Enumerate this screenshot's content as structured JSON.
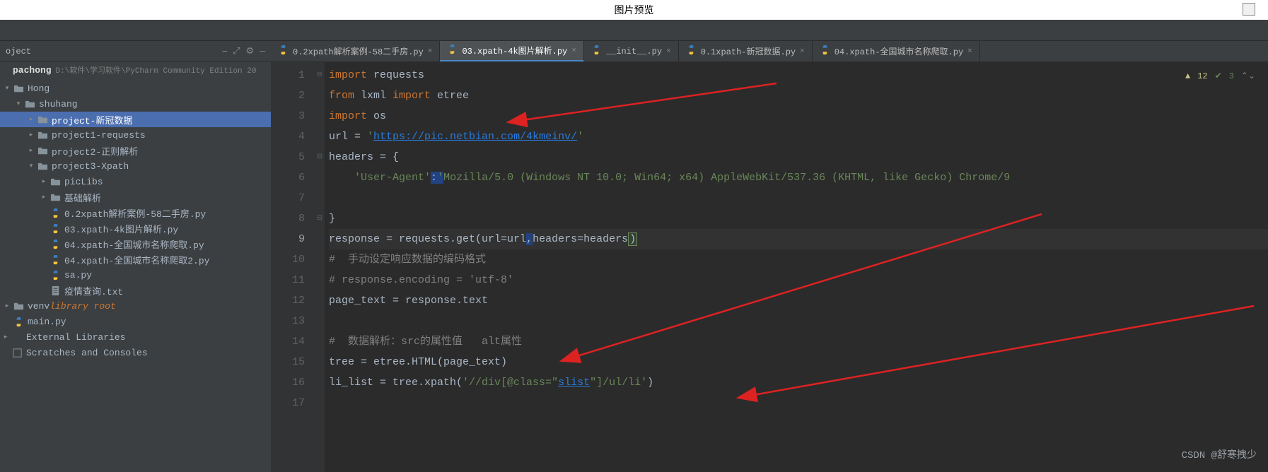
{
  "preview": {
    "title": "图片预览"
  },
  "sidebar": {
    "header_label": "oject",
    "active_project": "pachong",
    "project_path": "D:\\软件\\学习软件\\PyCharm Community Edition 20",
    "tree": [
      {
        "label": "Hong",
        "icon": "folder",
        "indent": 0,
        "arrow": "down",
        "sel": false
      },
      {
        "label": "shuhang",
        "icon": "folder",
        "indent": 1,
        "arrow": "down",
        "sel": false
      },
      {
        "label": "project-新冠数据",
        "icon": "folder",
        "indent": 2,
        "arrow": "right",
        "sel": true
      },
      {
        "label": "project1-requests",
        "icon": "folder",
        "indent": 2,
        "arrow": "right",
        "sel": false
      },
      {
        "label": "project2-正则解析",
        "icon": "folder",
        "indent": 2,
        "arrow": "right",
        "sel": false
      },
      {
        "label": "project3-Xpath",
        "icon": "folder",
        "indent": 2,
        "arrow": "down",
        "sel": false
      },
      {
        "label": "picLibs",
        "icon": "folder",
        "indent": 3,
        "arrow": "right",
        "sel": false
      },
      {
        "label": "基础解析",
        "icon": "folder",
        "indent": 3,
        "arrow": "right",
        "sel": false
      },
      {
        "label": "0.2xpath解析案例-58二手房.py",
        "icon": "py",
        "indent": 3,
        "arrow": "",
        "sel": false
      },
      {
        "label": "03.xpath-4k图片解析.py",
        "icon": "py",
        "indent": 3,
        "arrow": "",
        "sel": false
      },
      {
        "label": "04.xpath-全国城市名称爬取.py",
        "icon": "py",
        "indent": 3,
        "arrow": "",
        "sel": false
      },
      {
        "label": "04.xpath-全国城市名称爬取2.py",
        "icon": "py",
        "indent": 3,
        "arrow": "",
        "sel": false
      },
      {
        "label": "sa.py",
        "icon": "py",
        "indent": 3,
        "arrow": "",
        "sel": false
      },
      {
        "label": "疫情查询.txt",
        "icon": "txt",
        "indent": 3,
        "arrow": "",
        "sel": false
      },
      {
        "label": "venv",
        "icon": "folder",
        "indent": 0,
        "arrow": "right",
        "sel": false,
        "suffix": "library root",
        "suffix_class": "lib-root"
      },
      {
        "label": "main.py",
        "icon": "py",
        "indent": 0,
        "arrow": "",
        "sel": false
      },
      {
        "label": "External Libraries",
        "icon": "none",
        "indent": -1,
        "arrow": "right",
        "sel": false
      },
      {
        "label": "Scratches and Consoles",
        "icon": "scratch",
        "indent": -1,
        "arrow": "",
        "sel": false
      }
    ]
  },
  "tabs": [
    {
      "label": "0.2xpath解析案例-58二手房.py",
      "active": false
    },
    {
      "label": "03.xpath-4k图片解析.py",
      "active": true
    },
    {
      "label": "__init__.py",
      "active": false
    },
    {
      "label": "0.1xpath-新冠数据.py",
      "active": false
    },
    {
      "label": "04.xpath-全国城市名称爬取.py",
      "active": false
    }
  ],
  "editor": {
    "warnings": "12",
    "oks": "3",
    "current_line": 9,
    "lines": [
      {
        "n": 1,
        "html": "<span class='kw'>import</span> requests"
      },
      {
        "n": 2,
        "html": "<span class='kw'>from</span> lxml <span class='kw'>import</span> etree"
      },
      {
        "n": 3,
        "html": "<span class='kw'>import</span> os"
      },
      {
        "n": 4,
        "html": "url = <span class='str'>'</span><span class='link'>https://pic.netbian.com/4kmeinv/</span><span class='str'>'</span>"
      },
      {
        "n": 5,
        "html": "headers = {"
      },
      {
        "n": 6,
        "html": "    <span class='str'>'User-Agent'</span><span class='sel'>:</span><span class='str'><span class='sel'>'</span>Mozilla/5.0 (Windows NT 10.0; Win64; x64) AppleWebKit/537.36 (KHTML, like Gecko) Chrome/9</span>"
      },
      {
        "n": 7,
        "html": ""
      },
      {
        "n": 8,
        "html": "}"
      },
      {
        "n": 9,
        "html": "response = requests.get(url=url<span class='sel'>,</span>headers=headers<span class='caret'>)</span>"
      },
      {
        "n": 10,
        "html": "<span class='com'>#  手动设定响应数据的编码格式</span>"
      },
      {
        "n": 11,
        "html": "<span class='com'># response.encoding = 'utf-8'</span>"
      },
      {
        "n": 12,
        "html": "page_text = response.text"
      },
      {
        "n": 13,
        "html": ""
      },
      {
        "n": 14,
        "html": "<span class='com'>#  数据解析：src的属性值   alt属性</span>"
      },
      {
        "n": 15,
        "html": "tree = etree.HTML(page_text)"
      },
      {
        "n": 16,
        "html": "li_list = tree.xpath(<span class='str'>'//div[@class=\"</span><span class='link'>slist</span><span class='str'>\"]/ul/li'</span>)"
      },
      {
        "n": 17,
        "html": ""
      }
    ],
    "folds": {
      "5": "-",
      "8": "-"
    },
    "method_marks": {
      "1": true,
      "5": true,
      "8": true
    }
  },
  "watermark": "CSDN @舒寒拽少"
}
